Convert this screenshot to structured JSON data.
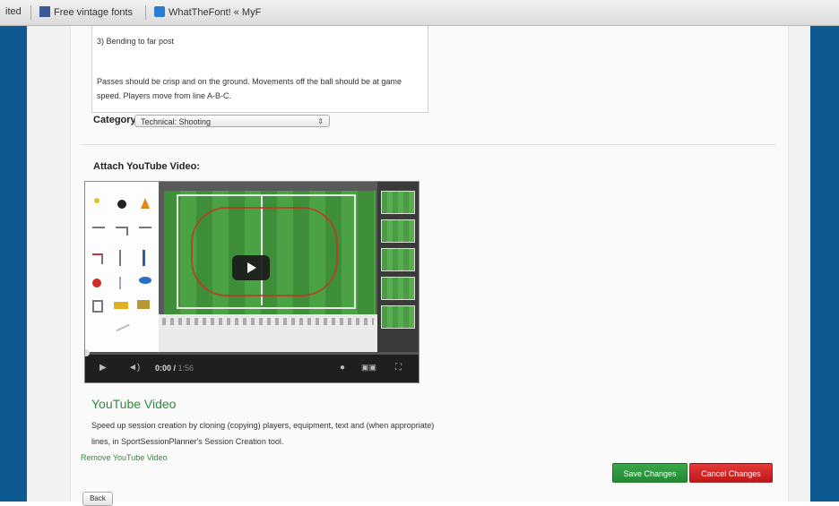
{
  "bookmarks": {
    "items": [
      {
        "label": "ited"
      },
      {
        "label": "Free vintage fonts"
      },
      {
        "label": "WhatTheFont! « MyF"
      }
    ]
  },
  "session": {
    "desc_line1": "3) Bending to far post",
    "desc_para": "Passes should be crisp and on the ground. Movements off the ball should be at game speed. Players move from line A-B-C.",
    "category_label": "Category:",
    "category_value": "Technical: Shooting"
  },
  "video": {
    "section_label": "Attach YouTube Video:",
    "time_current": "0:00",
    "time_total": "1:56",
    "progress": 0,
    "title": "YouTube Video",
    "description": "Speed up session creation by cloning (copying) players, equipment, text and (when appropriate) lines, in SportSessionPlanner's Session Creation tool.",
    "remove_label": "Remove YouTube Video"
  },
  "actions": {
    "save_label": "Save Changes",
    "cancel_label": "Cancel Changes",
    "back_label": "Back"
  },
  "colors": {
    "band": "#0d5a93",
    "save": "#2f9a40",
    "cancel": "#d42020",
    "link": "#2e8b3a"
  }
}
